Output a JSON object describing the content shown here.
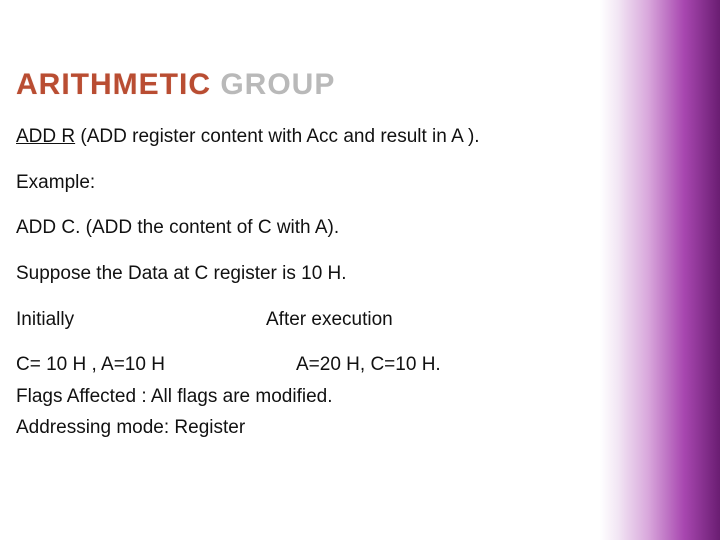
{
  "title": {
    "part1": "ARITHMETIC",
    "part2": "GROUP"
  },
  "lines": {
    "addr_label": "ADD R",
    "addr_desc": " (ADD register content with Acc and result in A ).",
    "example_label": "Example:",
    "addc": "ADD C. (ADD the content of C with A).",
    "suppose": "Suppose the Data at  C register is 10 H.",
    "initially": "Initially",
    "after": "After execution",
    "before_vals": "C= 10 H , A=10 H",
    "after_vals": "A=20 H, C=10 H.",
    "flags": "Flags Affected : All flags are modified.",
    "mode": "Addressing mode: Register"
  }
}
